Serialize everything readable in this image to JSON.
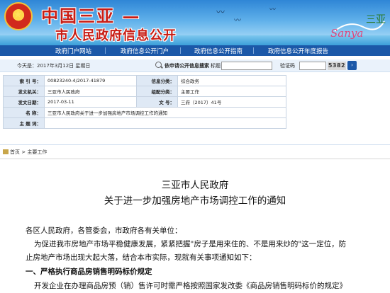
{
  "banner": {
    "site_title": "中国三亚 —",
    "site_subtitle": "市人民政府信息公开",
    "logo_text": "Sanya三亚"
  },
  "nav": {
    "items": [
      {
        "label": "政府门户网站"
      },
      {
        "label": "政府信息公开门户"
      },
      {
        "label": "政府信息公开指南"
      },
      {
        "label": "政府信息公开年度报告"
      }
    ]
  },
  "meta": {
    "date": "今天是：2017年3月12日 星期日",
    "search_label": "依申请公开信息搜索",
    "field1_label": "标题",
    "field2_label": "验证码",
    "captcha": "5382"
  },
  "info": {
    "rows": [
      {
        "l1": "索 引 号：",
        "v1": "00823240-4/2017-41879",
        "l2": "信息分类：",
        "v2": "综合政务"
      },
      {
        "l1": "发文机关：",
        "v1": "三亚市人民政府",
        "l2": "组配分类：",
        "v2": "主要工作"
      },
      {
        "l1": "发文日期：",
        "v1": "2017-03-11",
        "l2": "文 号：",
        "v2": "三府（2017）41号"
      }
    ],
    "name_label": "名 称：",
    "name_value": "三亚市人民政府关于进一步加强房地产市场调控工作的通知",
    "topic_label": "主 题 词："
  },
  "breadcrumb": {
    "home": "首页",
    "sep": " > ",
    "current": "主要工作"
  },
  "doc": {
    "title1": "三亚市人民政府",
    "title2": "关于进一步加强房地产市场调控工作的通知",
    "salutation": "各区人民政府，各管委会，市政府各有关单位：",
    "para1_line1": "为促进我市房地产市场平稳健康发展，紧紧把握\"房子是用来住的、不是用来炒的\"这一定位，防",
    "para1_line2": "止房地产市场出现大起大落，结合本市实际，现就有关事项通知如下：",
    "heading1": "一、严格执行商品房销售明码标价规定",
    "para2_line1": "开发企业在办理商品房预（销）售许可时需严格按照国家发改委《商品房销售明码标价的规定》"
  }
}
